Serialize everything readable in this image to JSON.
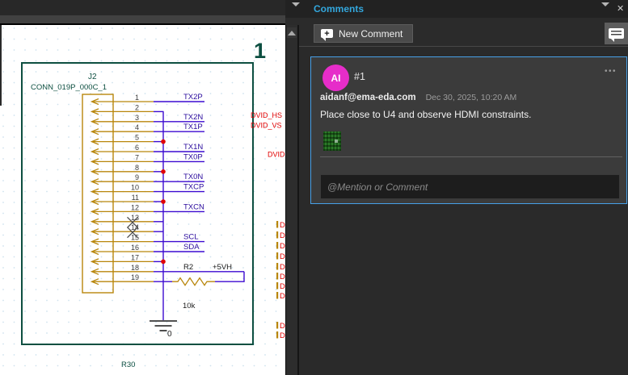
{
  "header": {
    "title": "Comments",
    "close_glyph": "✕",
    "more_glyph": "•••"
  },
  "toolbar": {
    "new_comment_label": "New Comment"
  },
  "comment": {
    "avatar_initials": "AI",
    "id": "#1",
    "author_email": "aidanf@ema-eda.com",
    "timestamp": "Dec 30, 2025, 10:20 AM",
    "body": "Place close to U4 and observe HDMI constraints.",
    "reply_placeholder": "@Mention or Comment"
  },
  "schematic": {
    "page_number": "1",
    "connector_refdes": "J2",
    "connector_part": "CONN_019P_000C_1",
    "pin_numbers": [
      "1",
      "2",
      "3",
      "4",
      "5",
      "6",
      "7",
      "8",
      "9",
      "10",
      "11",
      "12",
      "13",
      "14",
      "15",
      "16",
      "17",
      "18",
      "19"
    ],
    "net_labels": {
      "1": "TX2P",
      "3": "TX2N",
      "4": "TX1P",
      "6": "TX1N",
      "7": "TX0P",
      "9": "TX0N",
      "10": "TXCP",
      "12": "TXCN",
      "15": "SCL",
      "16": "SDA"
    },
    "junction_pins": [
      5,
      8,
      11,
      17
    ],
    "no_connect_pins": [
      13,
      14
    ],
    "resistor_refdes": "R2",
    "resistor_value": "10k",
    "power_net": "+5VH",
    "ground_net": "0",
    "offpage_labels": [
      "DVID_HS",
      "DVID_VS",
      "DVID"
    ],
    "clipped_right_labels": [
      "D",
      "D",
      "D",
      "D",
      "D",
      "D",
      "D",
      "D",
      "D",
      "D"
    ],
    "bottom_refdes": "R30",
    "colors": {
      "page": "#0d4f41",
      "connector": "#b8860b",
      "wire": "#3c0ad0",
      "net_label": "#2b0b9e",
      "pin_number": "#3a3a3a",
      "junction": "#e00000",
      "offpage_red": "#e00000",
      "plain_black": "#1a1a1a",
      "grid_dot": "#cfe2ee",
      "accent_blue": "#47a0e8",
      "title_cyan": "#33a7dd",
      "avatar_pink": "#e62dc9"
    }
  }
}
